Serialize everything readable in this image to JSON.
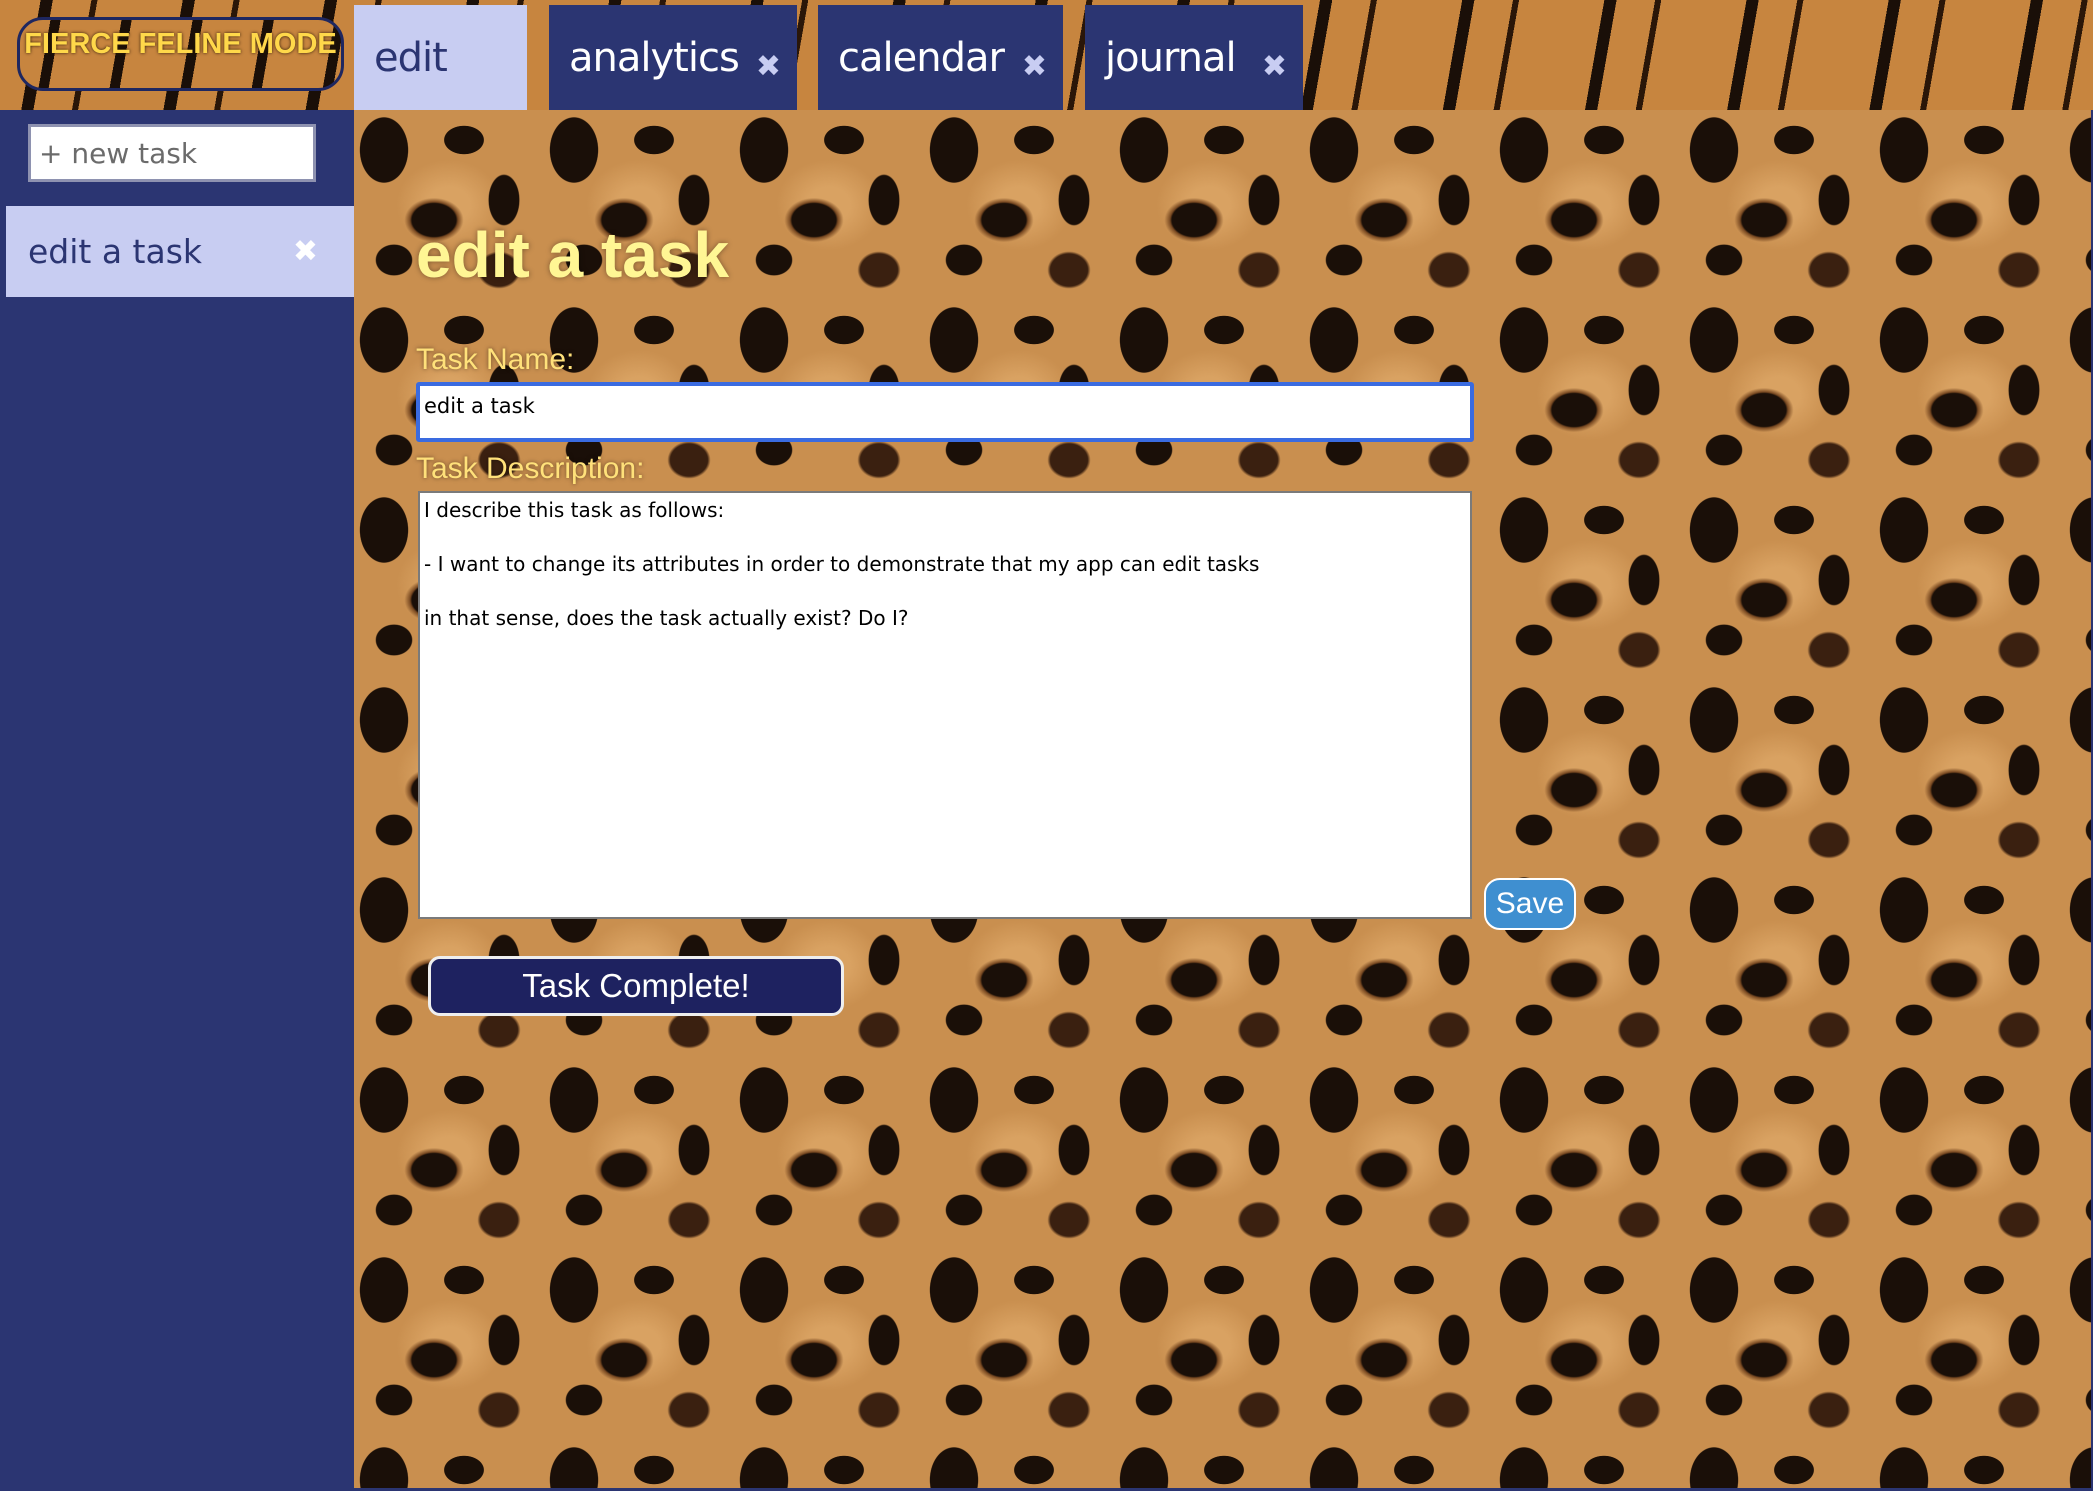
{
  "brand": {
    "label": "FIERCE FELINE MODE"
  },
  "tabs": [
    {
      "label": "edit",
      "active": true
    },
    {
      "label": "analytics",
      "close": "✖"
    },
    {
      "label": "calendar",
      "close": "✖"
    },
    {
      "label": "journal",
      "close": "✖"
    }
  ],
  "sidebar": {
    "new_task_placeholder": "+ new task",
    "items": [
      {
        "label": "edit a task",
        "close": "✖"
      }
    ]
  },
  "editor": {
    "heading": "edit a task",
    "name_label": "Task Name:",
    "name_value": "edit a task",
    "desc_label": "Task Description:",
    "desc_value": "I describe this task as follows:\n\n- I want to change its attributes in order to demonstrate that my app can edit tasks\n\nin that sense, does the task actually exist? Do I?",
    "save_label": "Save",
    "complete_label": "Task Complete!"
  },
  "colors": {
    "navy": "#2b3572",
    "tab_active": "#c8cdf2",
    "heading": "#fff694",
    "label": "#ffe17a",
    "save": "#3f8fd0",
    "complete": "#1e2260"
  }
}
